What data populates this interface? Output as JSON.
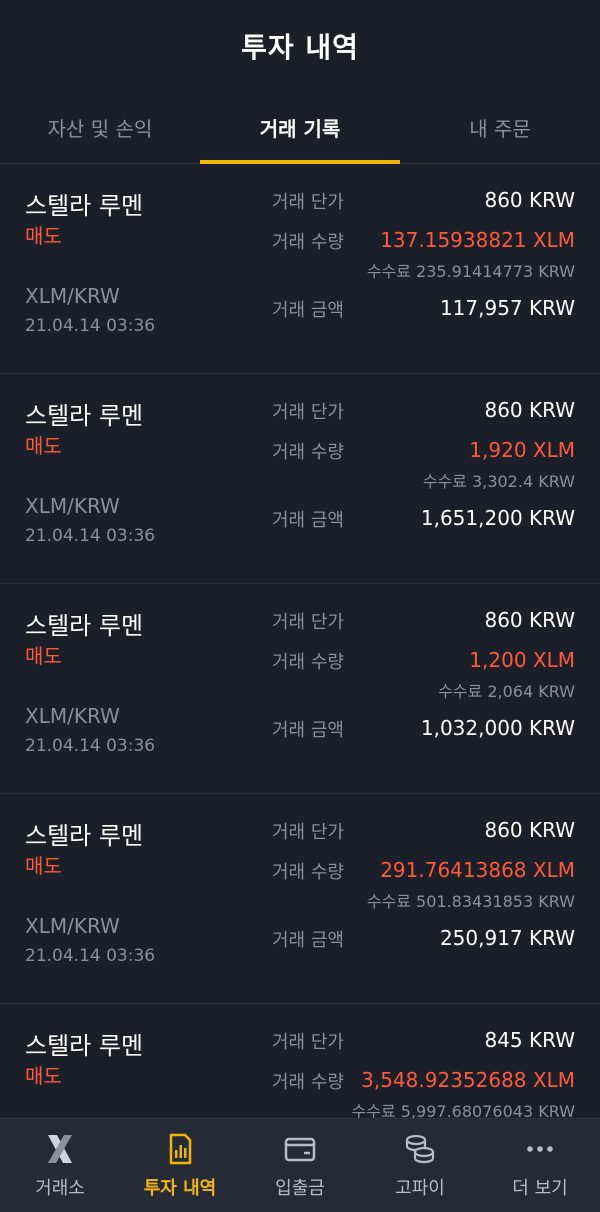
{
  "header": {
    "title": "투자 내역"
  },
  "tabs": [
    {
      "label": "자산 및 손익",
      "active": false
    },
    {
      "label": "거래 기록",
      "active": true
    },
    {
      "label": "내 주문",
      "active": false
    }
  ],
  "labels": {
    "price": "거래 단가",
    "qty": "거래 수량",
    "amount": "거래 금액"
  },
  "trades": [
    {
      "coin": "스텔라 루멘",
      "side": "매도",
      "pair": "XLM/KRW",
      "time": "21.04.14 03:36",
      "price": "860 KRW",
      "qty": "137.15938821 XLM",
      "fee": "수수료 235.91414773 KRW",
      "amount": "117,957 KRW"
    },
    {
      "coin": "스텔라 루멘",
      "side": "매도",
      "pair": "XLM/KRW",
      "time": "21.04.14 03:36",
      "price": "860 KRW",
      "qty": "1,920 XLM",
      "fee": "수수료 3,302.4 KRW",
      "amount": "1,651,200 KRW"
    },
    {
      "coin": "스텔라 루멘",
      "side": "매도",
      "pair": "XLM/KRW",
      "time": "21.04.14 03:36",
      "price": "860 KRW",
      "qty": "1,200 XLM",
      "fee": "수수료 2,064 KRW",
      "amount": "1,032,000 KRW"
    },
    {
      "coin": "스텔라 루멘",
      "side": "매도",
      "pair": "XLM/KRW",
      "time": "21.04.14 03:36",
      "price": "860 KRW",
      "qty": "291.76413868 XLM",
      "fee": "수수료 501.83431853 KRW",
      "amount": "250,917 KRW"
    },
    {
      "coin": "스텔라 루멘",
      "side": "매도",
      "pair": "",
      "time": "",
      "price": "845 KRW",
      "qty": "3,548.92352688 XLM",
      "fee": "수수료 5,997.68076043 KRW",
      "amount": ""
    }
  ],
  "bottom_nav": [
    {
      "label": "거래소",
      "icon": "exchange-x-icon",
      "active": false
    },
    {
      "label": "투자 내역",
      "icon": "chart-document-icon",
      "active": true
    },
    {
      "label": "입출금",
      "icon": "wallet-icon",
      "active": false
    },
    {
      "label": "고파이",
      "icon": "coins-stack-icon",
      "active": false
    },
    {
      "label": "더 보기",
      "icon": "more-dots-icon",
      "active": false
    }
  ],
  "colors": {
    "background": "#1b1f2a",
    "accent": "#f2b705",
    "sell": "#ff5a36",
    "muted": "#8a8f99"
  }
}
